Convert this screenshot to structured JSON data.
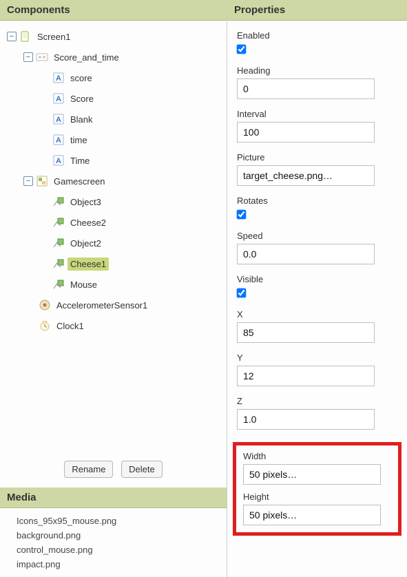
{
  "panels": {
    "components_title": "Components",
    "properties_title": "Properties",
    "media_title": "Media"
  },
  "tree": {
    "screen1": "Screen1",
    "score_and_time": "Score_and_time",
    "score_l": "score",
    "score_u": "Score",
    "blank": "Blank",
    "time_l": "time",
    "time_u": "Time",
    "gamescreen": "Gamescreen",
    "object3": "Object3",
    "cheese2": "Cheese2",
    "object2": "Object2",
    "cheese1": "Cheese1",
    "mouse": "Mouse",
    "accel": "AccelerometerSensor1",
    "clock1": "Clock1"
  },
  "buttons": {
    "rename": "Rename",
    "delete": "Delete"
  },
  "media": {
    "items": {
      "0": "Icons_95x95_mouse.png",
      "1": "background.png",
      "2": "control_mouse.png",
      "3": "impact.png"
    }
  },
  "props": {
    "enabled": {
      "label": "Enabled",
      "checked": true
    },
    "heading": {
      "label": "Heading",
      "value": "0"
    },
    "interval": {
      "label": "Interval",
      "value": "100"
    },
    "picture": {
      "label": "Picture",
      "value": "target_cheese.png…"
    },
    "rotates": {
      "label": "Rotates",
      "checked": true
    },
    "speed": {
      "label": "Speed",
      "value": "0.0"
    },
    "visible": {
      "label": "Visible",
      "checked": true
    },
    "x": {
      "label": "X",
      "value": "85"
    },
    "y": {
      "label": "Y",
      "value": "12"
    },
    "z": {
      "label": "Z",
      "value": "1.0"
    },
    "width": {
      "label": "Width",
      "value": "50 pixels…"
    },
    "height": {
      "label": "Height",
      "value": "50 pixels…"
    }
  }
}
